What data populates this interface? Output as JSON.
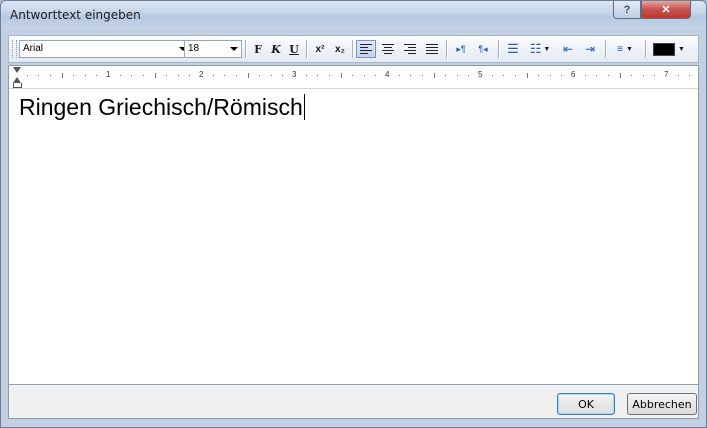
{
  "window": {
    "title": "Antworttext eingeben",
    "help_glyph": "?",
    "close_glyph": "✕"
  },
  "toolbar": {
    "font_family": "Arial",
    "font_size": "18",
    "bold_label": "F",
    "italic_label": "K",
    "underline_label": "U",
    "superscript_label": "x²",
    "subscript_label": "x₂",
    "text_color": "#000000"
  },
  "ruler": {
    "numbers": [
      "1",
      "2",
      "3",
      "4",
      "5",
      "6",
      "7"
    ]
  },
  "editor": {
    "content": "Ringen Griechisch/Römisch"
  },
  "buttons": {
    "ok": "OK",
    "cancel": "Abbrechen"
  }
}
